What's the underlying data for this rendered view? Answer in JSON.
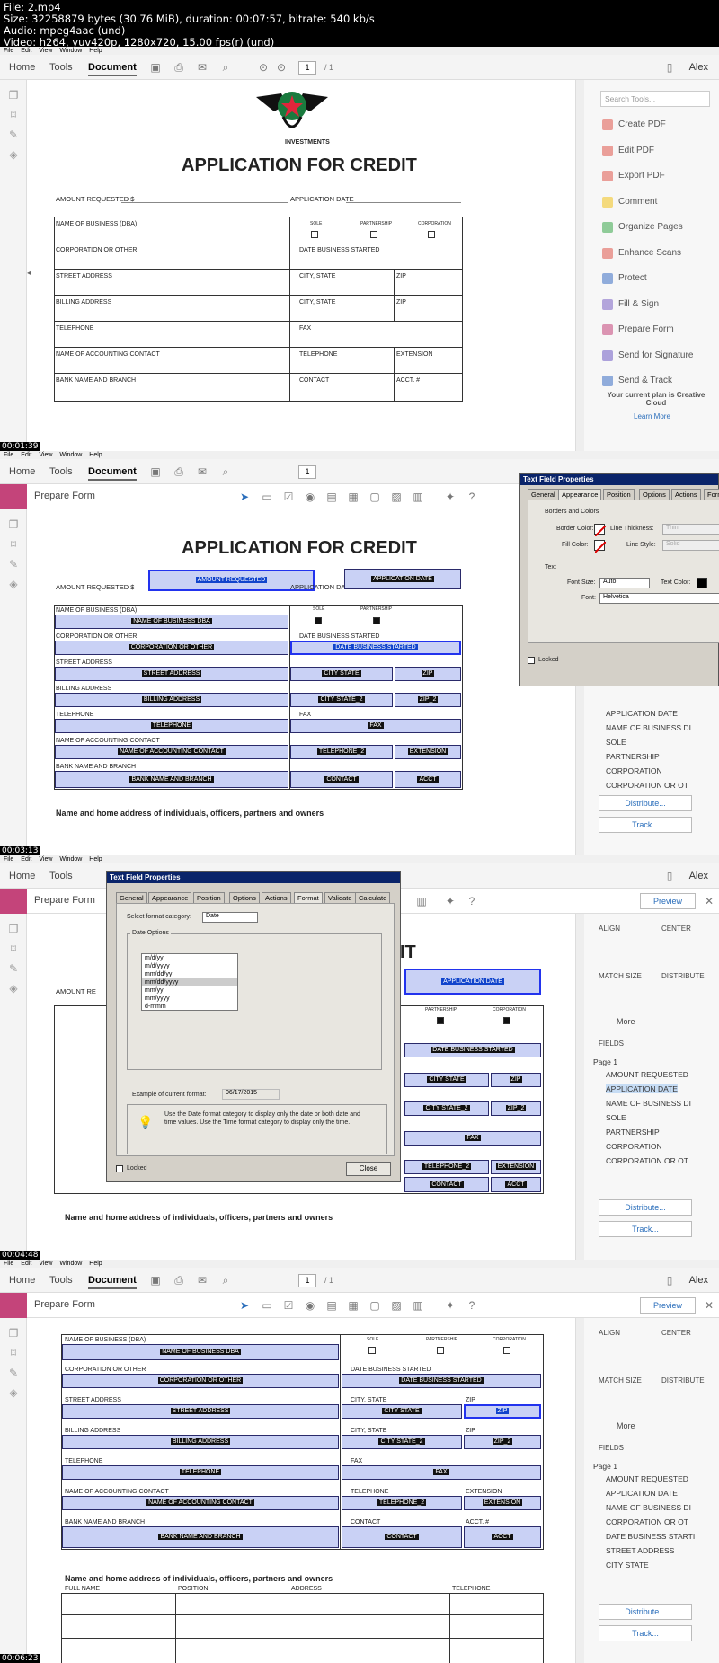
{
  "file_header": {
    "line1": "File: 2.mp4",
    "line2": "Size: 32258879 bytes (30.76 MiB), duration: 00:07:57, bitrate: 540 kb/s",
    "line3": "Audio: mpeg4aac (und)",
    "line4": "Video: h264, yuv420p, 1280x720, 15.00 fps(r) (und)"
  },
  "menu": [
    "File",
    "Edit",
    "View",
    "Window",
    "Help"
  ],
  "tabs": {
    "home": "Home",
    "tools": "Tools",
    "document": "Document"
  },
  "page": {
    "current": "1",
    "total": "/ 1"
  },
  "user": "Alex",
  "prepare_form": "Prepare Form",
  "timestamps": [
    "00:01:39",
    "00:03:13",
    "00:04:48",
    "00:06:23"
  ],
  "doc": {
    "title": "APPLICATION FOR CREDIT",
    "logo_text": "INVESTMENTS",
    "amount_requested": "AMOUNT REQUESTED $",
    "application_date": "APPLICATION DATE",
    "sole": "SOLE",
    "partnership": "PARTNERSHIP",
    "corporation": "CORPORATION",
    "rows": [
      {
        "left": "NAME OF BUSINESS (DBA)",
        "right": ""
      },
      {
        "left": "CORPORATION OR OTHER",
        "right": "DATE BUSINESS STARTED"
      },
      {
        "left": "STREET ADDRESS",
        "right": "CITY, STATE",
        "extra": "ZIP"
      },
      {
        "left": "BILLING ADDRESS",
        "right": "CITY, STATE",
        "extra": "ZIP"
      },
      {
        "left": "TELEPHONE",
        "right": "FAX"
      },
      {
        "left": "NAME OF ACCOUNTING CONTACT",
        "right": "TELEPHONE",
        "extra": "EXTENSION"
      },
      {
        "left": "BANK NAME AND BRANCH",
        "right": "CONTACT",
        "extra": "ACCT. #"
      }
    ],
    "owners_heading": "Name and home address of individuals, officers, partners and owners",
    "owners_cols": [
      "FULL NAME",
      "POSITION",
      "ADDRESS",
      "TELEPHONE"
    ]
  },
  "fields": {
    "amount": "AMOUNT REQUESTED",
    "app_date": "APPLICATION DATE",
    "name_dba": "NAME OF BUSINESS DBA",
    "corp_other": "CORPORATION OR OTHER",
    "date_started": "DATE BUSINESS STARTED",
    "street": "STREET ADDRESS",
    "city": "CITY STATE",
    "zip": "ZIP",
    "billing": "BILLING ADDRESS",
    "city2": "CITY STATE_2",
    "zip2": "ZIP_2",
    "telephone": "TELEPHONE",
    "fax": "FAX",
    "acct_contact": "NAME OF ACCOUNTING CONTACT",
    "telephone2": "TELEPHONE_2",
    "extension": "EXTENSION",
    "bank": "BANK NAME AND BRANCH",
    "contact": "CONTACT",
    "acct": "ACCT",
    "sole_chk": "S",
    "part_chk": "P",
    "corp_chk": "C"
  },
  "tools": [
    {
      "label": "Create PDF",
      "color": "#e0584c"
    },
    {
      "label": "Edit PDF",
      "color": "#e0584c"
    },
    {
      "label": "Export PDF",
      "color": "#e0584c"
    },
    {
      "label": "Comment",
      "color": "#f3c21a"
    },
    {
      "label": "Organize Pages",
      "color": "#3aa84b"
    },
    {
      "label": "Enhance Scans",
      "color": "#e0584c"
    },
    {
      "label": "Protect",
      "color": "#3d6fc4"
    },
    {
      "label": "Fill & Sign",
      "color": "#7b62c4"
    },
    {
      "label": "Prepare Form",
      "color": "#c4447a"
    },
    {
      "label": "Send for Signature",
      "color": "#6f5bc4"
    },
    {
      "label": "Send & Track",
      "color": "#3d6fc4"
    }
  ],
  "search_tools": "Search Tools...",
  "plan": "Your current plan is Creative Cloud",
  "learn_more": "Learn More",
  "appearance_dlg": {
    "title": "Text Field Properties",
    "tabs": [
      "General",
      "Appearance",
      "Position",
      "Options",
      "Actions",
      "Format"
    ],
    "borders_colors": "Borders and Colors",
    "border_color": "Border Color:",
    "line_thickness": "Line Thickness:",
    "line_thickness_val": "Thin",
    "fill_color": "Fill Color:",
    "line_style": "Line Style:",
    "line_style_val": "Solid",
    "text": "Text",
    "font_size": "Font Size:",
    "font_size_val": "Auto",
    "text_color": "Text Color:",
    "font": "Font:",
    "font_val": "Helvetica",
    "locked": "Locked"
  },
  "format_dlg": {
    "title": "Text Field Properties",
    "tabs": [
      "General",
      "Appearance",
      "Position",
      "Options",
      "Actions",
      "Format",
      "Validate",
      "Calculate"
    ],
    "select_category": "Select format category:",
    "category": "Date",
    "date_options": "Date Options",
    "formats": [
      "m/d/yy",
      "m/d/yyyy",
      "mm/dd/yy",
      "mm/dd/yyyy",
      "mm/yy",
      "mm/yyyy",
      "d-mmm"
    ],
    "example_label": "Example of current format:",
    "example_val": "06/17/2015",
    "tip": "Use the Date format category to display only the date or both date and time values. Use the Time format category to display only the time.",
    "locked": "Locked",
    "close": "Close"
  },
  "right_panel": {
    "preview": "Preview",
    "align": "ALIGN",
    "center": "CENTER",
    "match_size": "MATCH SIZE",
    "distribute": "DISTRIBUTE",
    "more": "More",
    "fields": "FIELDS",
    "page1": "Page 1",
    "distribute_btn": "Distribute...",
    "track_btn": "Track..."
  },
  "tree2": [
    "APPLICATION DATE",
    "NAME OF BUSINESS DI",
    "SOLE",
    "PARTNERSHIP",
    "CORPORATION",
    "CORPORATION OR OT"
  ],
  "tree3": [
    "AMOUNT REQUESTED",
    "APPLICATION DATE",
    "NAME OF BUSINESS DI",
    "SOLE",
    "PARTNERSHIP",
    "CORPORATION",
    "CORPORATION OR OT"
  ],
  "tree4": [
    "AMOUNT REQUESTED",
    "APPLICATION DATE",
    "NAME OF BUSINESS DI",
    "CORPORATION OR OT",
    "DATE BUSINESS STARTI",
    "STREET ADDRESS",
    "CITY STATE"
  ]
}
